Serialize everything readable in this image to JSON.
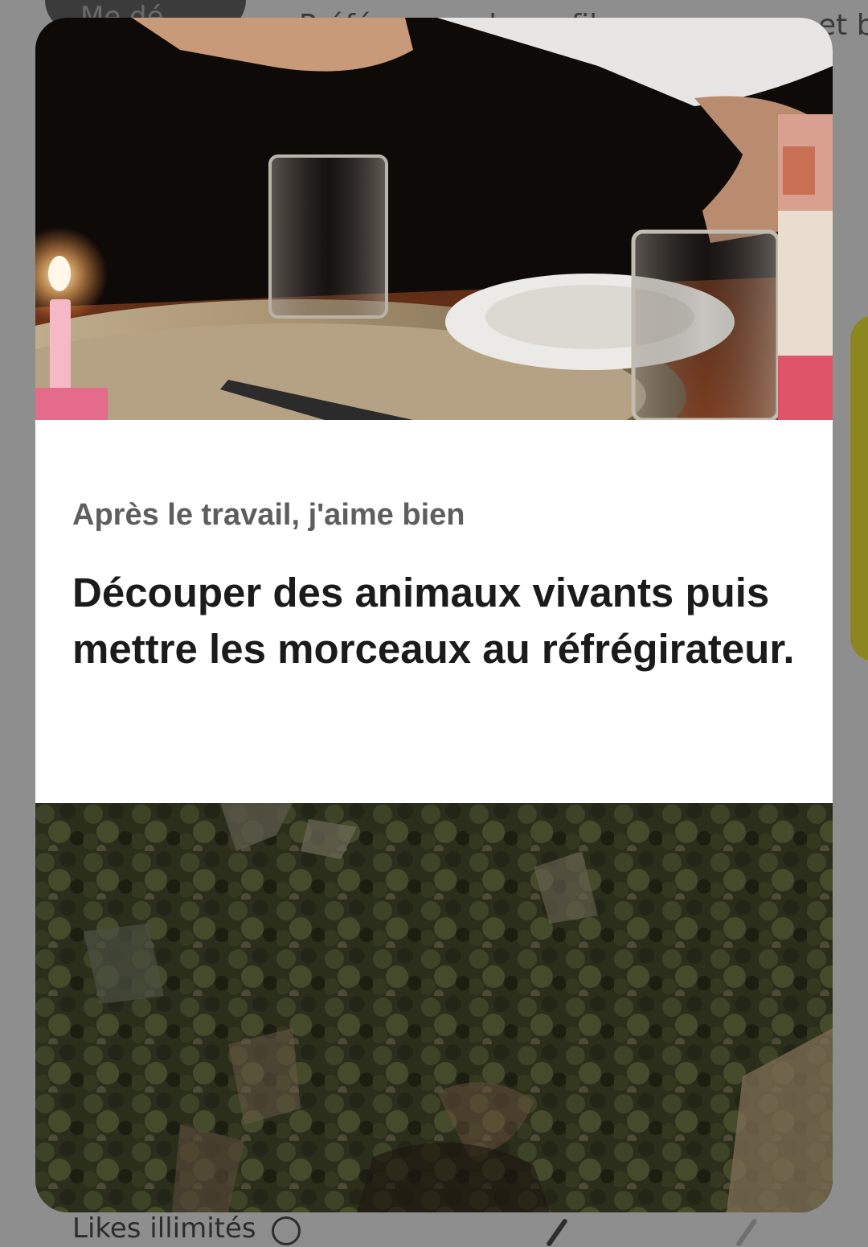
{
  "background": {
    "pill_label": "Me dé",
    "top_text_1": "Préférences de profil",
    "top_text_2": "et b",
    "bottom_label": "Likes illimités"
  },
  "card": {
    "photo_1": {
      "description_icon": "dinner-table-photo"
    },
    "prompt": {
      "label": "Après le travail, j'aime bien",
      "answer": "Découper des animaux vivants puis mettre les morceaux au réfrégirateur."
    },
    "photo_2": {
      "description_icon": "forest-hillside-photo"
    }
  },
  "colors": {
    "overlay": "#8d8d8d",
    "card_bg": "#ffffff",
    "prompt_label": "#5e5e5e",
    "prompt_answer": "#1b1b1b",
    "accent_yellow": "#8c8620"
  }
}
